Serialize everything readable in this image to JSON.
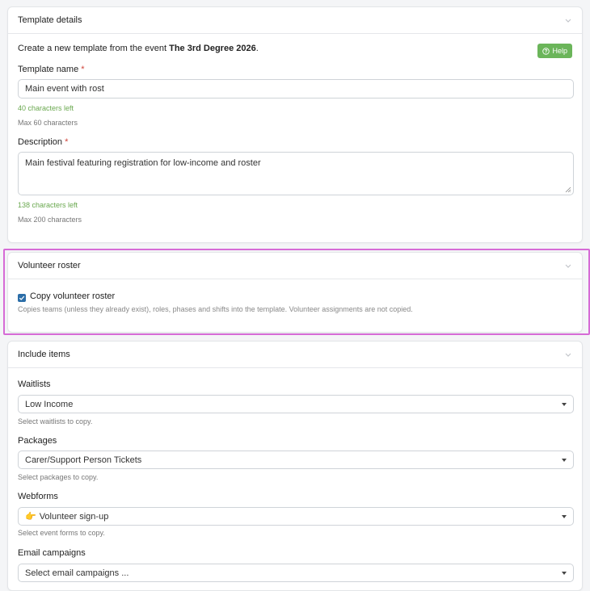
{
  "template_details": {
    "title": "Template details",
    "intro_text": "Create a new template from the event",
    "event_name": "The 3rd Degree 2026",
    "intro_suffix": ".",
    "help_label": "Help",
    "name_label": "Template name",
    "required_mark": "*",
    "name_value": "Main event with rost",
    "name_chars_left": "40 characters left",
    "name_max": "Max 60 characters",
    "description_label": "Description",
    "description_value": "Main festival featuring registration for low-income and roster",
    "description_chars_left": "138 characters left",
    "description_max": "Max 200 characters"
  },
  "volunteer_roster": {
    "title": "Volunteer roster",
    "checkbox_label": "Copy volunteer roster",
    "checkbox_checked": true,
    "help_text": "Copies teams (unless they already exist), roles, phases and shifts into the template. Volunteer assignments are not copied."
  },
  "include_items": {
    "title": "Include items",
    "waitlists_label": "Waitlists",
    "waitlists_value": "Low Income",
    "waitlists_help": "Select waitlists to copy.",
    "packages_label": "Packages",
    "packages_value": "Carer/Support Person Tickets",
    "packages_help": "Select packages to copy.",
    "webforms_label": "Webforms",
    "webforms_emoji": "👉",
    "webforms_value": "Volunteer sign-up",
    "webforms_help": "Select event forms to copy.",
    "email_label": "Email campaigns",
    "email_placeholder": "Select email campaigns ..."
  },
  "colors": {
    "accent_green": "#6bb55a",
    "checkbox_blue": "#2c6ea8",
    "highlight_magenta": "#d66bd6",
    "required_red": "#d0453b"
  }
}
